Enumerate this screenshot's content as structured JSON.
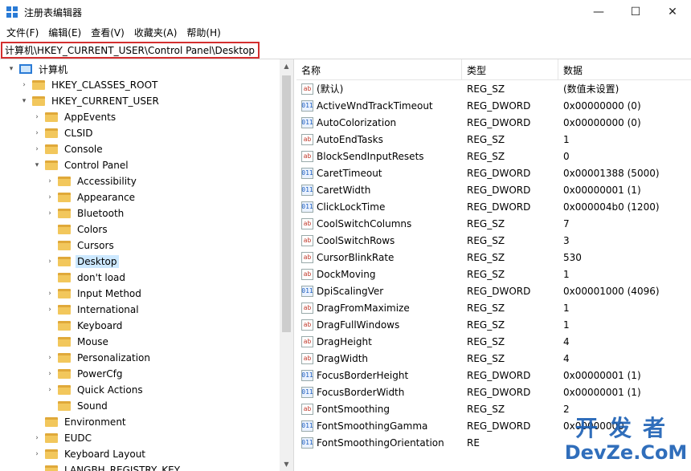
{
  "window": {
    "title": "注册表编辑器",
    "minimize": "—",
    "maximize": "☐",
    "close": "✕"
  },
  "menu": [
    "文件(F)",
    "编辑(E)",
    "查看(V)",
    "收藏夹(A)",
    "帮助(H)"
  ],
  "address": "计算机\\HKEY_CURRENT_USER\\Control Panel\\Desktop",
  "tree": [
    {
      "label": "计算机",
      "level": 0,
      "arrow": "down",
      "kind": "computer"
    },
    {
      "label": "HKEY_CLASSES_ROOT",
      "level": 1,
      "arrow": "right"
    },
    {
      "label": "HKEY_CURRENT_USER",
      "level": 1,
      "arrow": "down"
    },
    {
      "label": "AppEvents",
      "level": 2,
      "arrow": "right"
    },
    {
      "label": "CLSID",
      "level": 2,
      "arrow": "right"
    },
    {
      "label": "Console",
      "level": 2,
      "arrow": "right"
    },
    {
      "label": "Control Panel",
      "level": 2,
      "arrow": "down"
    },
    {
      "label": "Accessibility",
      "level": 3,
      "arrow": "right"
    },
    {
      "label": "Appearance",
      "level": 3,
      "arrow": "right"
    },
    {
      "label": "Bluetooth",
      "level": 3,
      "arrow": "right"
    },
    {
      "label": "Colors",
      "level": 3,
      "arrow": ""
    },
    {
      "label": "Cursors",
      "level": 3,
      "arrow": ""
    },
    {
      "label": "Desktop",
      "level": 3,
      "arrow": "right",
      "selected": true
    },
    {
      "label": "don't load",
      "level": 3,
      "arrow": ""
    },
    {
      "label": "Input Method",
      "level": 3,
      "arrow": "right"
    },
    {
      "label": "International",
      "level": 3,
      "arrow": "right"
    },
    {
      "label": "Keyboard",
      "level": 3,
      "arrow": ""
    },
    {
      "label": "Mouse",
      "level": 3,
      "arrow": ""
    },
    {
      "label": "Personalization",
      "level": 3,
      "arrow": "right"
    },
    {
      "label": "PowerCfg",
      "level": 3,
      "arrow": "right"
    },
    {
      "label": "Quick Actions",
      "level": 3,
      "arrow": "right"
    },
    {
      "label": "Sound",
      "level": 3,
      "arrow": ""
    },
    {
      "label": "Environment",
      "level": 2,
      "arrow": ""
    },
    {
      "label": "EUDC",
      "level": 2,
      "arrow": "right"
    },
    {
      "label": "Keyboard Layout",
      "level": 2,
      "arrow": "right"
    },
    {
      "label": "LANGBH_REGISTRY_KEY",
      "level": 2,
      "arrow": ""
    }
  ],
  "columns": {
    "name": "名称",
    "type": "类型",
    "data": "数据"
  },
  "values": [
    {
      "name": "(默认)",
      "type": "REG_SZ",
      "data": "(数值未设置)",
      "icon": "sz"
    },
    {
      "name": "ActiveWndTrackTimeout",
      "type": "REG_DWORD",
      "data": "0x00000000 (0)",
      "icon": "dword"
    },
    {
      "name": "AutoColorization",
      "type": "REG_DWORD",
      "data": "0x00000000 (0)",
      "icon": "dword"
    },
    {
      "name": "AutoEndTasks",
      "type": "REG_SZ",
      "data": "1",
      "icon": "sz"
    },
    {
      "name": "BlockSendInputResets",
      "type": "REG_SZ",
      "data": "0",
      "icon": "sz"
    },
    {
      "name": "CaretTimeout",
      "type": "REG_DWORD",
      "data": "0x00001388 (5000)",
      "icon": "dword"
    },
    {
      "name": "CaretWidth",
      "type": "REG_DWORD",
      "data": "0x00000001 (1)",
      "icon": "dword"
    },
    {
      "name": "ClickLockTime",
      "type": "REG_DWORD",
      "data": "0x000004b0 (1200)",
      "icon": "dword"
    },
    {
      "name": "CoolSwitchColumns",
      "type": "REG_SZ",
      "data": "7",
      "icon": "sz"
    },
    {
      "name": "CoolSwitchRows",
      "type": "REG_SZ",
      "data": "3",
      "icon": "sz"
    },
    {
      "name": "CursorBlinkRate",
      "type": "REG_SZ",
      "data": "530",
      "icon": "sz"
    },
    {
      "name": "DockMoving",
      "type": "REG_SZ",
      "data": "1",
      "icon": "sz"
    },
    {
      "name": "DpiScalingVer",
      "type": "REG_DWORD",
      "data": "0x00001000 (4096)",
      "icon": "dword"
    },
    {
      "name": "DragFromMaximize",
      "type": "REG_SZ",
      "data": "1",
      "icon": "sz"
    },
    {
      "name": "DragFullWindows",
      "type": "REG_SZ",
      "data": "1",
      "icon": "sz"
    },
    {
      "name": "DragHeight",
      "type": "REG_SZ",
      "data": "4",
      "icon": "sz"
    },
    {
      "name": "DragWidth",
      "type": "REG_SZ",
      "data": "4",
      "icon": "sz"
    },
    {
      "name": "FocusBorderHeight",
      "type": "REG_DWORD",
      "data": "0x00000001 (1)",
      "icon": "dword"
    },
    {
      "name": "FocusBorderWidth",
      "type": "REG_DWORD",
      "data": "0x00000001 (1)",
      "icon": "dword"
    },
    {
      "name": "FontSmoothing",
      "type": "REG_SZ",
      "data": "2",
      "icon": "sz"
    },
    {
      "name": "FontSmoothingGamma",
      "type": "REG_DWORD",
      "data": "0x00000000",
      "icon": "dword"
    },
    {
      "name": "FontSmoothingOrientation",
      "type": "RE",
      "data": "",
      "icon": "dword"
    }
  ],
  "watermark": {
    "line1": "开发者",
    "line2": "DevZe.CoM"
  }
}
